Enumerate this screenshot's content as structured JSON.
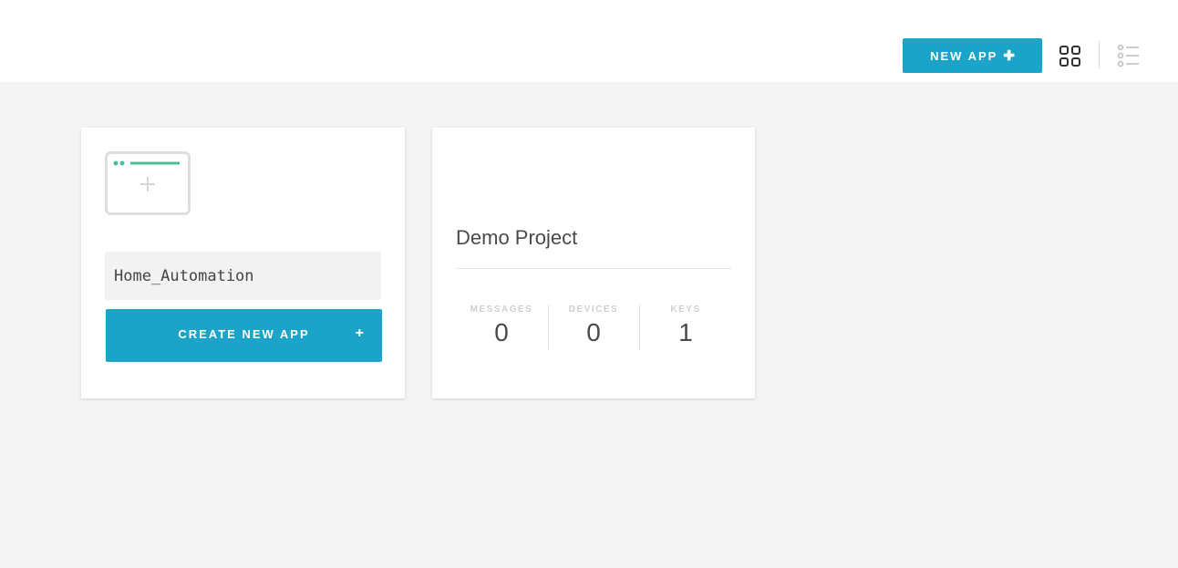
{
  "header": {
    "new_app_label": "NEW APP",
    "new_app_icon": "plus-icon",
    "grid_view_icon": "grid-view-icon",
    "list_view_icon": "list-view-icon"
  },
  "new_app_card": {
    "icon": "app-window-plus-icon",
    "app_name_value": "Home_Automation",
    "create_button_label": "CREATE NEW APP",
    "create_button_icon": "+"
  },
  "demo_project_card": {
    "title": "Demo Project",
    "stats": [
      {
        "label": "MESSAGES",
        "value": "0"
      },
      {
        "label": "DEVICES",
        "value": "0"
      },
      {
        "label": "KEYS",
        "value": "1"
      }
    ]
  },
  "colors": {
    "accent": "#1ba3c8",
    "icon_green": "#4cbf94",
    "background": "#f4f4f4"
  }
}
